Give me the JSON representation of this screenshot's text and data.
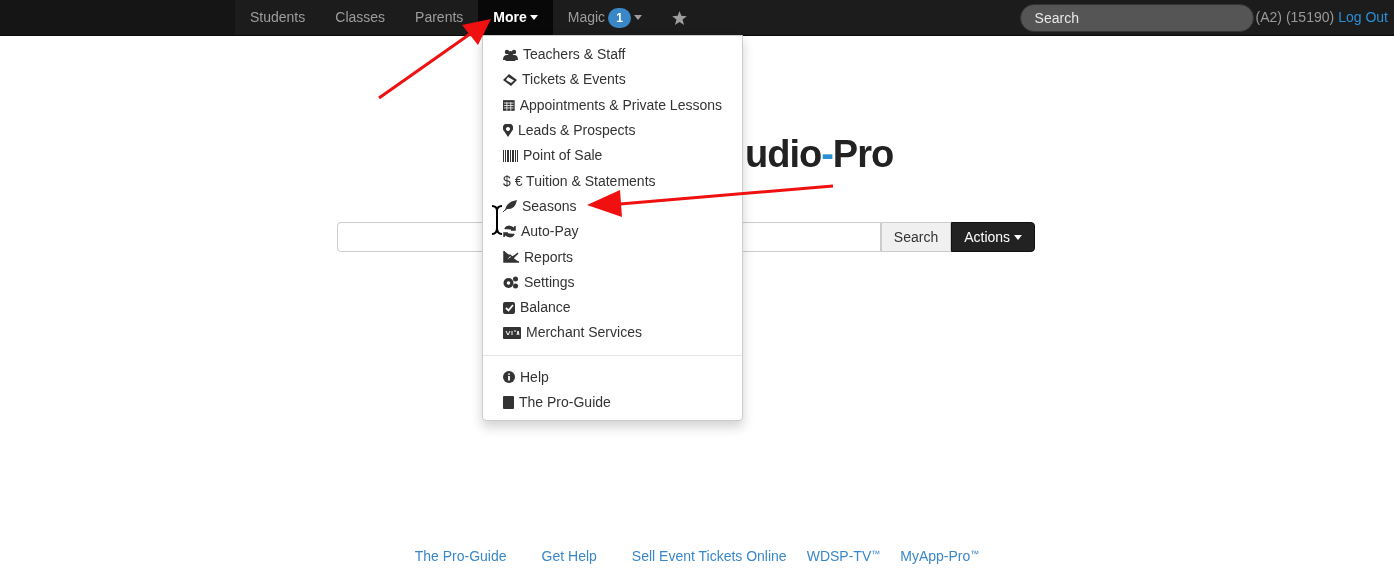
{
  "navbar": {
    "items": [
      {
        "label": "Students",
        "selected": false
      },
      {
        "label": "Classes",
        "selected": false
      },
      {
        "label": "Parents",
        "selected": false
      },
      {
        "label": "More",
        "selected": true,
        "caret": true
      },
      {
        "label": "Magic",
        "selected": false,
        "badge": "1",
        "caret": true
      }
    ],
    "search": {
      "placeholder": "Search"
    },
    "account": "(A2) (15190)",
    "logout": "Log Out"
  },
  "dropdown": {
    "sections": [
      [
        "Teachers & Staff",
        "Tickets & Events",
        "Appointments & Private Lessons",
        "Leads & Prospects",
        "Point of Sale",
        "$ € Tuition & Statements",
        "Seasons",
        "Auto-Pay",
        "Reports",
        "Settings",
        "Balance",
        "Merchant Services"
      ],
      [
        "Help",
        "The Pro-Guide"
      ]
    ]
  },
  "logo": {
    "before": "udio",
    "separator": "-",
    "after": "Pro"
  },
  "search_bar": {
    "button": "Search",
    "actions": "Actions"
  },
  "footer": [
    {
      "text": "The Pro-Guide"
    },
    {
      "text": "Get Help"
    },
    {
      "text": "Sell Event Tickets Online"
    },
    {
      "text": "WDSP-TV",
      "mark": "™"
    },
    {
      "text": "MyApp-Pro",
      "mark": "™"
    }
  ]
}
